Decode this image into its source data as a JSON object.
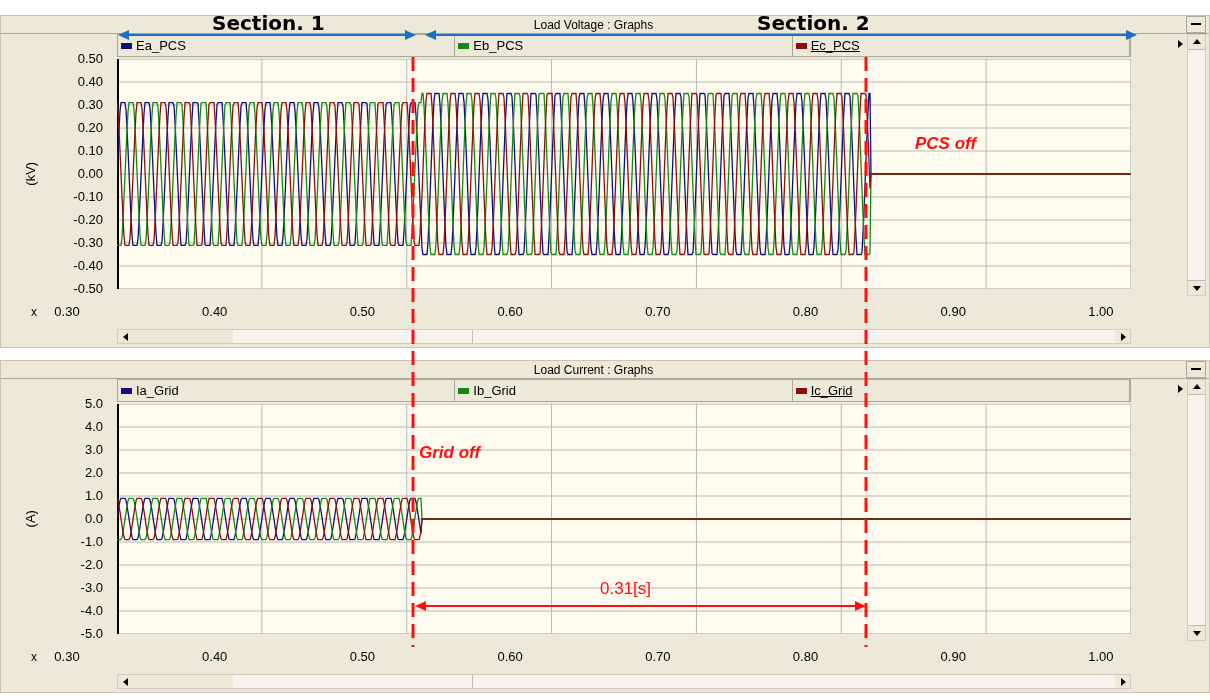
{
  "annotations": {
    "section_labels": [
      "Section. 1",
      "Section. 2"
    ],
    "pcs_off": "PCS off",
    "grid_off": "Grid off",
    "interval": "0.31[s]"
  },
  "panels": [
    {
      "title": "Load Voltage : Graphs",
      "legend": [
        {
          "name": "Ea_PCS",
          "color": "#10107a",
          "focused": false
        },
        {
          "name": "Eb_PCS",
          "color": "#128a12",
          "focused": false
        },
        {
          "name": "Ec_PCS",
          "color": "#8a1010",
          "focused": true
        }
      ],
      "y_label": "(kV)",
      "yticks": [
        "0.50",
        "0.40",
        "0.30",
        "0.20",
        "0.10",
        "0.00",
        "-0.10",
        "-0.20",
        "-0.30",
        "-0.40",
        "-0.50"
      ],
      "x_label": "x",
      "xticks": [
        "0.30",
        "0.40",
        "0.50",
        "0.60",
        "0.70",
        "0.80",
        "0.90",
        "1.00"
      ]
    },
    {
      "title": "Load Current : Graphs",
      "legend": [
        {
          "name": "Ia_Grid",
          "color": "#10107a",
          "focused": false
        },
        {
          "name": "Ib_Grid",
          "color": "#128a12",
          "focused": false
        },
        {
          "name": "Ic_Grid",
          "color": "#8a1010",
          "focused": true
        }
      ],
      "y_label": "(A)",
      "yticks": [
        "5.0",
        "4.0",
        "3.0",
        "2.0",
        "1.0",
        "0.0",
        "-1.0",
        "-2.0",
        "-3.0",
        "-4.0",
        "-5.0"
      ],
      "x_label": "x",
      "xticks": [
        "0.30",
        "0.40",
        "0.50",
        "0.60",
        "0.70",
        "0.80",
        "0.90",
        "1.00"
      ]
    }
  ]
}
